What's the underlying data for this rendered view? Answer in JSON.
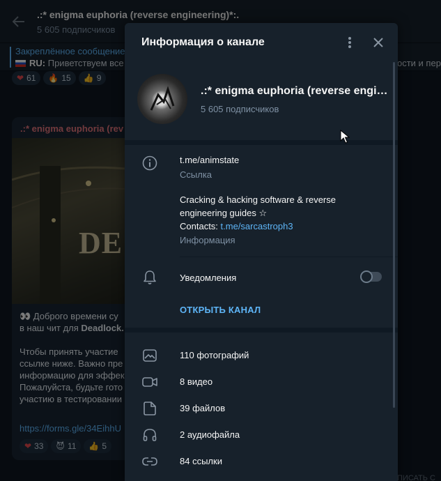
{
  "chat": {
    "title": ".:* enigma euphoria (reverse engineering)*:.",
    "subscribers": "5 605 подписчиков",
    "pinned_title": "Закреплённое сообщение",
    "pinned_lang": "RU:",
    "pinned_text": "Приветствуем все",
    "pinned_text_right": "ости и пер",
    "top_reactions": [
      {
        "emoji": "❤",
        "count": "61"
      },
      {
        "emoji": "🔥",
        "count": "15"
      },
      {
        "emoji": "👍",
        "count": "9"
      }
    ],
    "message": {
      "author": ".:* enigma euphoria (rev",
      "image_word": "DE",
      "lines": [
        {
          "before": "👀 Доброго времени су",
          "bold": ""
        },
        {
          "before": "в наш чит для ",
          "bold": "Deadlock."
        },
        {
          "before": "Чтобы принять участие",
          "bold": ""
        },
        {
          "before": "ссылке ниже. Важно пре",
          "bold": ""
        },
        {
          "before": "информацию для эффек",
          "bold": ""
        },
        {
          "before": "Пожалуйста, будьте гото",
          "bold": ""
        },
        {
          "before": "участию в тестировании",
          "bold": ""
        }
      ],
      "link": "https://forms.gle/34EihhU",
      "reactions": [
        {
          "emoji": "❤",
          "count": "33"
        },
        {
          "emoji": "😈",
          "count": "11"
        },
        {
          "emoji": "👍",
          "count": "5"
        }
      ]
    },
    "footer_right": "ПИСАТЬ С"
  },
  "modal": {
    "title": "Информация о канале",
    "channel_name": ".:* enigma euphoria (reverse engineering)*:.",
    "subscribers": "5 605 подписчиков",
    "link": "t.me/animstate",
    "link_caption": "Ссылка",
    "description_line1": "Cracking & hacking software & reverse",
    "description_line2": "engineering guides ☆",
    "contacts_label": "Contacts: ",
    "contacts_link": "t.me/sarcastroph3",
    "description_caption": "Информация",
    "notifications_label": "Уведомления",
    "notifications_on": false,
    "open_channel": "ОТКРЫТЬ КАНАЛ",
    "media": [
      {
        "icon": "photo-icon",
        "label": "110 фотографий"
      },
      {
        "icon": "video-icon",
        "label": "8 видео"
      },
      {
        "icon": "file-icon",
        "label": "39 файлов"
      },
      {
        "icon": "headphones-icon",
        "label": "2 аудиофайла"
      },
      {
        "icon": "link-icon",
        "label": "84 ссылки"
      }
    ]
  },
  "colors": {
    "accent": "#5eb5f7",
    "panel": "#17212b",
    "background": "#0e1621",
    "author": "#e4747b"
  }
}
